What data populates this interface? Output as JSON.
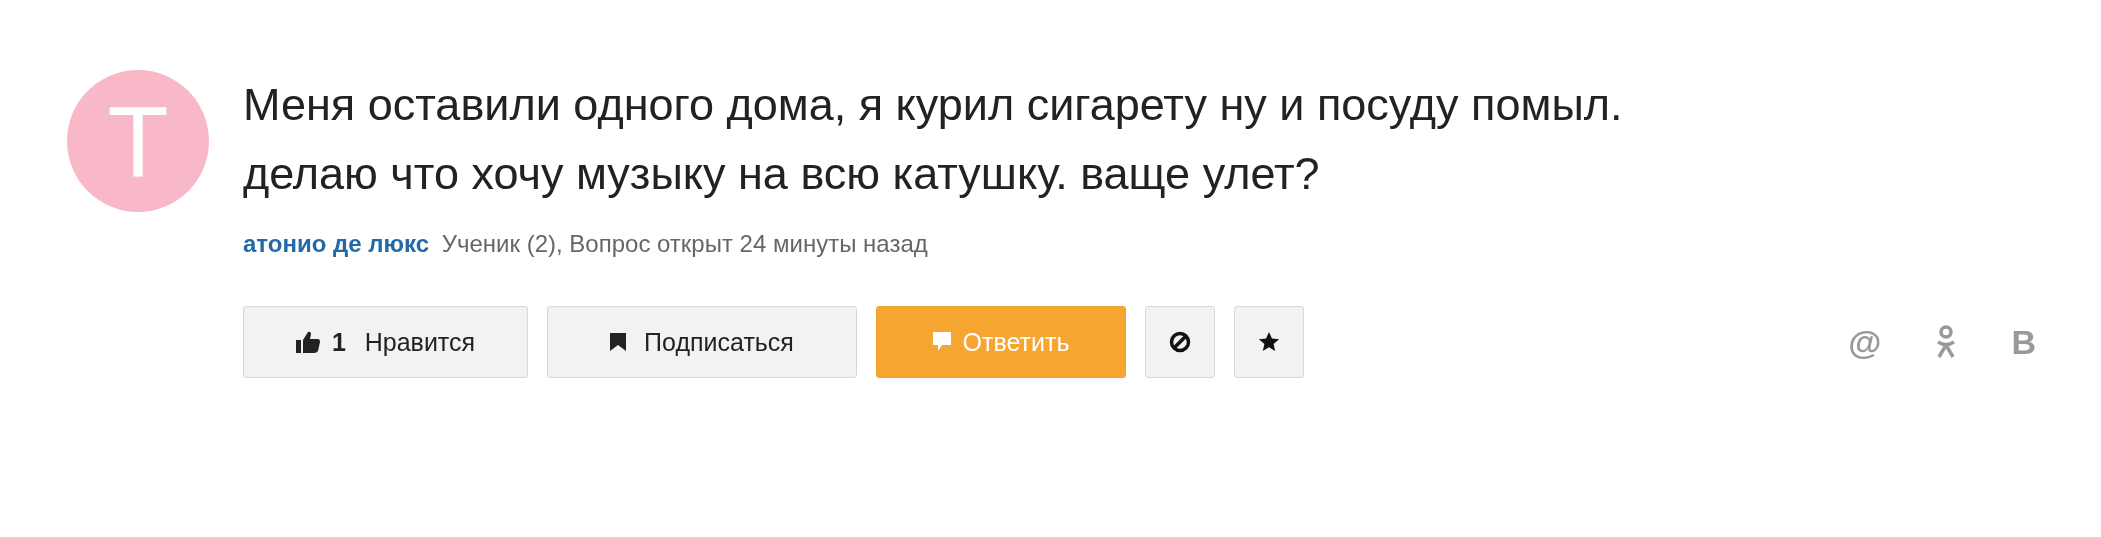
{
  "avatar": {
    "letter": "T",
    "color": "#f9b8c8"
  },
  "question": {
    "lines": [
      "Меня оставили одного дома, я курил сигарету ну и посуду помыл.",
      "делаю что хочу музыку на всю катушку. ваще улет?"
    ]
  },
  "meta": {
    "author": "атонио де люкс",
    "details": "Ученик (2), Вопрос открыт 24 минуты назад"
  },
  "actions": [
    {
      "kind": "like",
      "count": "1",
      "label": "Нравится"
    },
    {
      "kind": "subscribe",
      "label": "Подписаться"
    },
    {
      "kind": "reply",
      "label": "Ответить"
    },
    {
      "kind": "block"
    },
    {
      "kind": "star"
    }
  ],
  "share": [
    {
      "kind": "glyph",
      "text": "@"
    },
    {
      "kind": "figure"
    },
    {
      "kind": "glyph",
      "text": "В"
    }
  ]
}
